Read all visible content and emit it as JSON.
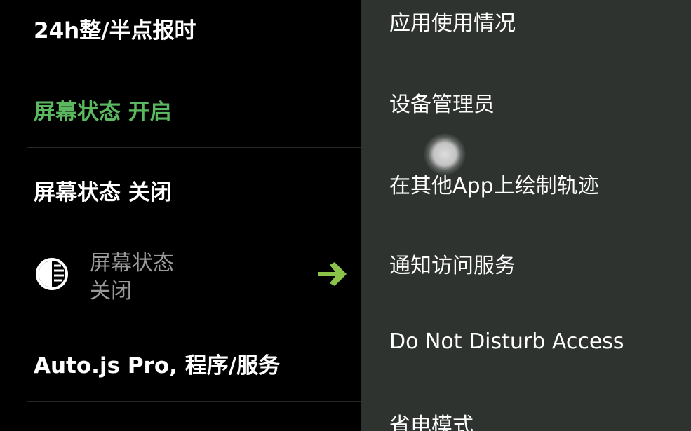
{
  "left_list": {
    "items": [
      {
        "label": "24h整/半点报时"
      },
      {
        "label": "屏幕状态 开启"
      },
      {
        "label": "屏幕状态 关闭"
      },
      {
        "label": "Auto.js Pro, 程序/服务"
      }
    ],
    "condition": {
      "icon": "contrast-icon",
      "line1": "屏幕状态",
      "line2": "关闭",
      "arrow_icon": "arrow-right-icon"
    }
  },
  "popup_menu": {
    "items": [
      {
        "label": "应用使用情况"
      },
      {
        "label": "设备管理员"
      },
      {
        "label": "在其他App上绘制轨迹"
      },
      {
        "label": "通知访问服务"
      },
      {
        "label": "Do Not Disturb Access"
      },
      {
        "label": "省电模式"
      }
    ]
  },
  "colors": {
    "background": "#000000",
    "menu_background": "#2e332f",
    "highlight_green": "#5cb860",
    "arrow_green": "#8bc34a",
    "secondary_text": "#9a9a9a"
  }
}
